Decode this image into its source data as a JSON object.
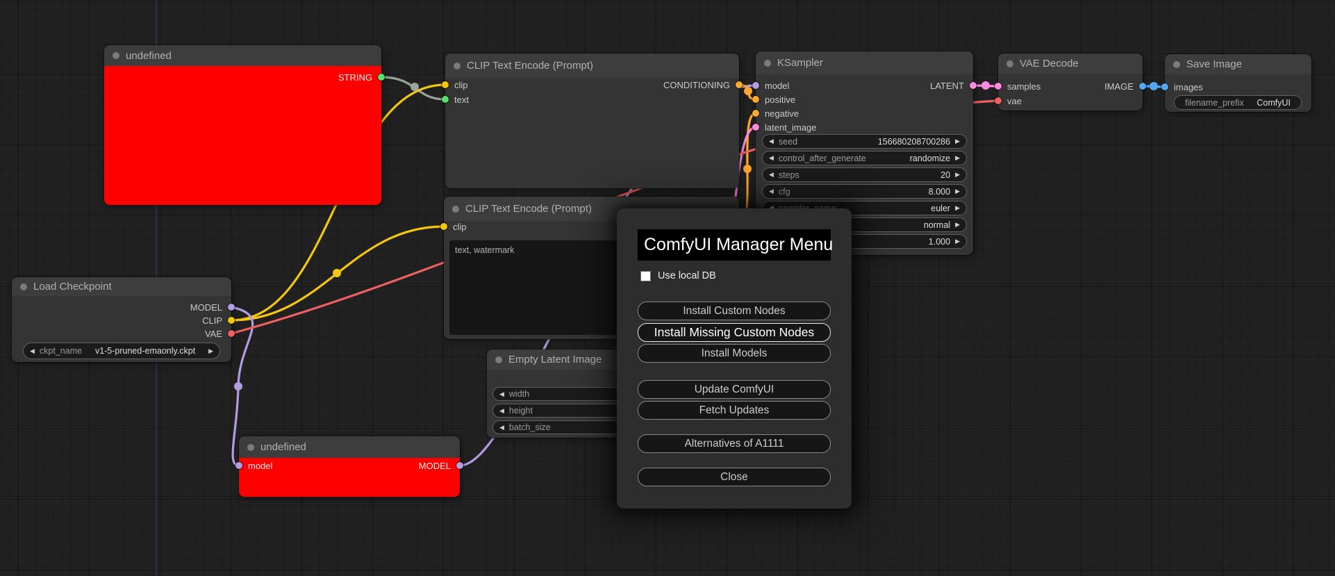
{
  "colors": {
    "model": "#b49ce3",
    "clip": "#f5c70e",
    "vae": "#ef6060",
    "conditioning": "#ffa831",
    "latent": "#ff8ae0",
    "image": "#52a9f0",
    "string": "#55e06a",
    "reroute_gray": "#9aa39b",
    "node_error": "#fe0000"
  },
  "icons": {
    "stepper_left": "◀",
    "stepper_right": "▶"
  },
  "nodes": {
    "undefined_top": {
      "title": "undefined",
      "outputs": {
        "string": {
          "label": "STRING"
        }
      }
    },
    "clip_encode_1": {
      "title": "CLIP Text Encode (Prompt)",
      "inputs": {
        "clip": {
          "label": "clip"
        },
        "text": {
          "label": "text"
        }
      },
      "outputs": {
        "conditioning": {
          "label": "CONDITIONING"
        }
      }
    },
    "clip_encode_2": {
      "title": "CLIP Text Encode (Prompt)",
      "inputs": {
        "clip": {
          "label": "clip"
        }
      },
      "text_value": "text, watermark"
    },
    "empty_latent": {
      "title": "Empty Latent Image",
      "widgets": [
        {
          "label": "width"
        },
        {
          "label": "height"
        },
        {
          "label": "batch_size"
        }
      ]
    },
    "undefined_bottom": {
      "title": "undefined",
      "inputs": {
        "model": {
          "label": "model"
        }
      },
      "outputs": {
        "model": {
          "label": "MODEL"
        }
      }
    },
    "load_checkpoint": {
      "title": "Load Checkpoint",
      "outputs": {
        "model": {
          "label": "MODEL"
        },
        "clip": {
          "label": "CLIP"
        },
        "vae": {
          "label": "VAE"
        }
      },
      "widgets": [
        {
          "label": "ckpt_name",
          "value": "v1-5-pruned-emaonly.ckpt"
        }
      ]
    },
    "ksampler": {
      "title": "KSampler",
      "inputs": {
        "model": {
          "label": "model"
        },
        "positive": {
          "label": "positive"
        },
        "negative": {
          "label": "negative"
        },
        "latent_image": {
          "label": "latent_image"
        }
      },
      "outputs": {
        "latent": {
          "label": "LATENT"
        }
      },
      "widgets": [
        {
          "label": "seed",
          "value": "156680208700286"
        },
        {
          "label": "control_after_generate",
          "value": "randomize"
        },
        {
          "label": "steps",
          "value": "20"
        },
        {
          "label": "cfg",
          "value": "8.000"
        },
        {
          "label": "sampler_name",
          "value": "euler"
        },
        {
          "label": "",
          "value": "normal"
        },
        {
          "label": "",
          "value": "1.000"
        }
      ]
    },
    "vae_decode": {
      "title": "VAE Decode",
      "inputs": {
        "samples": {
          "label": "samples"
        },
        "vae": {
          "label": "vae"
        }
      },
      "outputs": {
        "image": {
          "label": "IMAGE"
        }
      }
    },
    "save_image": {
      "title": "Save Image",
      "inputs": {
        "images": {
          "label": "images"
        }
      },
      "widgets": [
        {
          "label": "filename_prefix",
          "value": "ComfyUI"
        }
      ]
    }
  },
  "dialog": {
    "title": "ComfyUI Manager Menu",
    "checkbox_label": "Use local DB",
    "buttons": [
      "Install Custom Nodes",
      "Install Missing Custom Nodes",
      "Install Models",
      "Update ComfyUI",
      "Fetch Updates",
      "Alternatives of A1111",
      "Close"
    ]
  }
}
